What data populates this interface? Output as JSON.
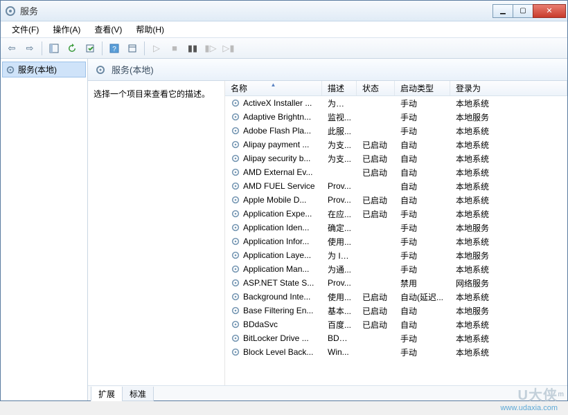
{
  "window": {
    "title": "服务"
  },
  "menu": {
    "file": "文件(F)",
    "action": "操作(A)",
    "view": "查看(V)",
    "help": "帮助(H)"
  },
  "tree": {
    "root": "服务(本地)"
  },
  "subheader": {
    "title": "服务(本地)"
  },
  "info": {
    "hint": "选择一个项目来查看它的描述。"
  },
  "columns": {
    "name": "名称",
    "desc": "描述",
    "status": "状态",
    "startup": "启动类型",
    "logon": "登录为"
  },
  "tabs": {
    "extended": "扩展",
    "standard": "标准"
  },
  "watermark": {
    "url": "www.udaxia.com",
    "logo": "U大侠"
  },
  "services": [
    {
      "name": "ActiveX Installer ...",
      "desc": "为从 ...",
      "status": "",
      "startup": "手动",
      "logon": "本地系统"
    },
    {
      "name": "Adaptive Brightn...",
      "desc": "监视...",
      "status": "",
      "startup": "手动",
      "logon": "本地服务"
    },
    {
      "name": "Adobe Flash Pla...",
      "desc": "此服...",
      "status": "",
      "startup": "手动",
      "logon": "本地系统"
    },
    {
      "name": "Alipay payment ...",
      "desc": "为支...",
      "status": "已启动",
      "startup": "自动",
      "logon": "本地系统"
    },
    {
      "name": "Alipay security b...",
      "desc": "为支...",
      "status": "已启动",
      "startup": "自动",
      "logon": "本地系统"
    },
    {
      "name": "AMD External Ev...",
      "desc": "",
      "status": "已启动",
      "startup": "自动",
      "logon": "本地系统"
    },
    {
      "name": "AMD FUEL Service",
      "desc": "Prov...",
      "status": "",
      "startup": "自动",
      "logon": "本地系统"
    },
    {
      "name": "Apple Mobile D...",
      "desc": "Prov...",
      "status": "已启动",
      "startup": "自动",
      "logon": "本地系统"
    },
    {
      "name": "Application Expe...",
      "desc": "在应...",
      "status": "已启动",
      "startup": "手动",
      "logon": "本地系统"
    },
    {
      "name": "Application Iden...",
      "desc": "确定...",
      "status": "",
      "startup": "手动",
      "logon": "本地服务"
    },
    {
      "name": "Application Infor...",
      "desc": "使用...",
      "status": "",
      "startup": "手动",
      "logon": "本地系统"
    },
    {
      "name": "Application Laye...",
      "desc": "为 In...",
      "status": "",
      "startup": "手动",
      "logon": "本地服务"
    },
    {
      "name": "Application Man...",
      "desc": "为通...",
      "status": "",
      "startup": "手动",
      "logon": "本地系统"
    },
    {
      "name": "ASP.NET State S...",
      "desc": "Prov...",
      "status": "",
      "startup": "禁用",
      "logon": "网络服务"
    },
    {
      "name": "Background Inte...",
      "desc": "使用...",
      "status": "已启动",
      "startup": "自动(延迟...",
      "logon": "本地系统"
    },
    {
      "name": "Base Filtering En...",
      "desc": "基本...",
      "status": "已启动",
      "startup": "自动",
      "logon": "本地服务"
    },
    {
      "name": "BDdaSvc",
      "desc": "百度...",
      "status": "已启动",
      "startup": "自动",
      "logon": "本地系统"
    },
    {
      "name": "BitLocker Drive ...",
      "desc": "BDE...",
      "status": "",
      "startup": "手动",
      "logon": "本地系统"
    },
    {
      "name": "Block Level Back...",
      "desc": "Win...",
      "status": "",
      "startup": "手动",
      "logon": "本地系统"
    }
  ]
}
